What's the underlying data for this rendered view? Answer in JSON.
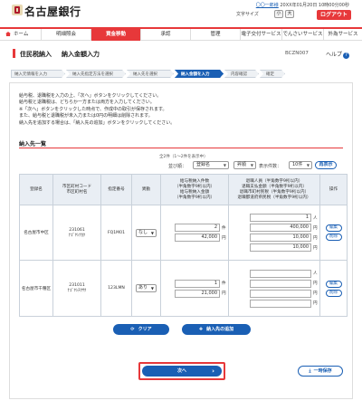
{
  "header": {
    "bank_name": "名古屋銀行",
    "user_name": "〇〇一郎様",
    "last_login": "20XX年01月20日 10時00分00秒",
    "font_size_label": "文字サイズ",
    "font_size_small": "小",
    "font_size_large": "大",
    "logout_label": "ログアウト"
  },
  "nav": {
    "items": [
      "ホーム",
      "明細照会",
      "資金移動",
      "承認",
      "管理",
      "電子交付サービス",
      "でんさいサービス",
      "外為サービス"
    ]
  },
  "page": {
    "title": "住民税納入",
    "subtitle": "納入金額入力",
    "screen_id": "BCZN007",
    "help_label": "ヘルプ"
  },
  "steps": [
    "納入元情報を入力",
    "納入先指定方法を選択",
    "納入先を選択",
    "納入金額を入力",
    "内容確認",
    "確定"
  ],
  "instructions": [
    "給与税、退職税を入力の上、「次へ」ボタンをクリックしてください。",
    "給与税と退職税は、どちらか一方または両方を入力してください。",
    "※「次へ」ボタンをクリックした時点で、作成中の取引が保存されます。",
    "また、給与税と退職税が未入力または0円の明細は削除されます。",
    "納入先を追加する場合は、「納入先の追加」ボタンをクリックしてください。"
  ],
  "list": {
    "section_title": "納入先一覧",
    "count_text": "全2件（1～2件を表示中）",
    "sort_label": "並び順：",
    "sort_field": "登録名",
    "sort_order": "昇順",
    "per_page_label": "表示件数：",
    "per_page": "10件",
    "resort_label": "再表示",
    "columns": {
      "name": "登録名",
      "code": [
        "市区町村コード",
        "市区町村名"
      ],
      "number": "指定番号",
      "special": "異動",
      "salary": [
        "給与税納入件数",
        "（半角数字9桁以内）",
        "給与税納入金額",
        "（半角数字9桁以内）"
      ],
      "retire": [
        "退職人員（半角数字9桁以内）",
        "退職支払金額（半角数字9桁以内）",
        "退職市町村民税（半角数字9桁以内）",
        "退職都道府県民税（半角数字9桁以内）"
      ],
      "operation": "操作"
    },
    "unit_person": "人",
    "unit_yen": "円",
    "unit_count": "件",
    "edit_label": "編集",
    "delete_label": "削除",
    "rows": [
      {
        "name": "名古屋市中区",
        "code": "231061",
        "city": "ﾅｺﾞﾔｼﾅｶｸ",
        "number": "FQ1M01",
        "special": "なし",
        "salary_count": "2",
        "salary_amount": "42,000",
        "retire_people": "1",
        "retire_payment": "400,000",
        "retire_city_tax": "10,000",
        "retire_pref_tax": "10,000"
      },
      {
        "name": "名古屋市千種区",
        "code": "231011",
        "city": "ﾅｺﾞﾔｼﾁｸｻｸ",
        "number": "123LMN",
        "special": "あり",
        "salary_count": "1",
        "salary_amount": "21,000",
        "retire_people": "",
        "retire_payment": "",
        "retire_city_tax": "",
        "retire_pref_tax": ""
      }
    ]
  },
  "actions": {
    "clear_label": "クリア",
    "add_label": "納入先の追加",
    "next_label": "次へ",
    "save_label": "一時保存"
  }
}
